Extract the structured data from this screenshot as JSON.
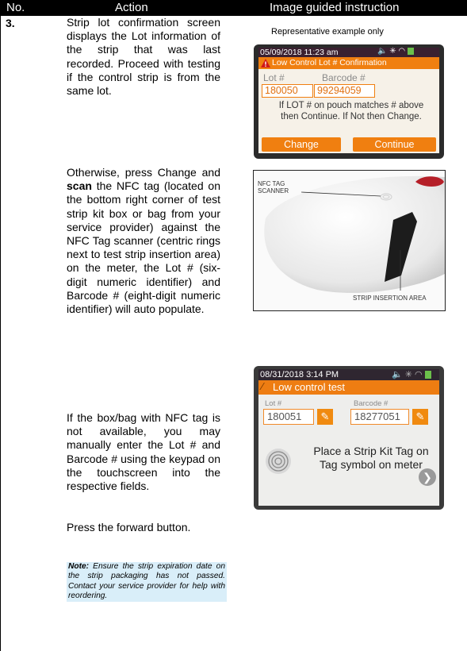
{
  "header": {
    "col_no": "No.",
    "col_action": "Action",
    "col_image": "Image guided instruction"
  },
  "row": {
    "number": "3.",
    "p1": "Strip lot confirmation screen displays the Lot information of the strip that was last recorded. Proceed with testing if the control strip is from the same lot.",
    "p2_a": "Otherwise, press Change and ",
    "p2_bold": "scan",
    "p2_b": " the NFC tag (located on the bottom right corner of test strip kit box or bag from your service provider) against the NFC Tag scanner (centric rings next to test strip insertion area) on the meter, the Lot # (six-digit numeric identifier) and Barcode # (eight-digit numeric identifier) will auto populate.",
    "p3": "If the box/bag with NFC tag is not available, you may manually enter the Lot # and Barcode # using the keypad on the touchscreen into the respective fields.",
    "p4": "Press the forward button.",
    "note_bold": "Note:",
    "note_text": " Ensure the strip expiration date on the strip packaging has not passed. Contact your service provider for help with reordering."
  },
  "caption": "Representative example only",
  "screen1": {
    "datetime": "05/09/2018 11:23 am",
    "title": "Low Control Lot # Confirmation",
    "lot_label": "Lot #",
    "barcode_label": "Barcode #",
    "lot_value": "180050",
    "barcode_value": "99294059",
    "message": "If LOT # on pouch matches # above then Continue. If Not then Change.",
    "btn_change": "Change",
    "btn_continue": "Continue"
  },
  "screen2": {
    "nfc_label_1": "NFC TAG",
    "nfc_label_2": "SCANNER",
    "strip_label": "STRIP INSERTION AREA"
  },
  "screen3": {
    "datetime": "08/31/2018 3:14 PM",
    "title": "Low control test",
    "lot_label": "Lot #",
    "barcode_label": "Barcode #",
    "lot_value": "180051",
    "barcode_value": "18277051",
    "message": "Place a Strip Kit Tag on Tag symbol on meter"
  },
  "colors": {
    "accent": "#f07f10",
    "header_bg": "#000000",
    "note_bg": "#d9eef9"
  }
}
